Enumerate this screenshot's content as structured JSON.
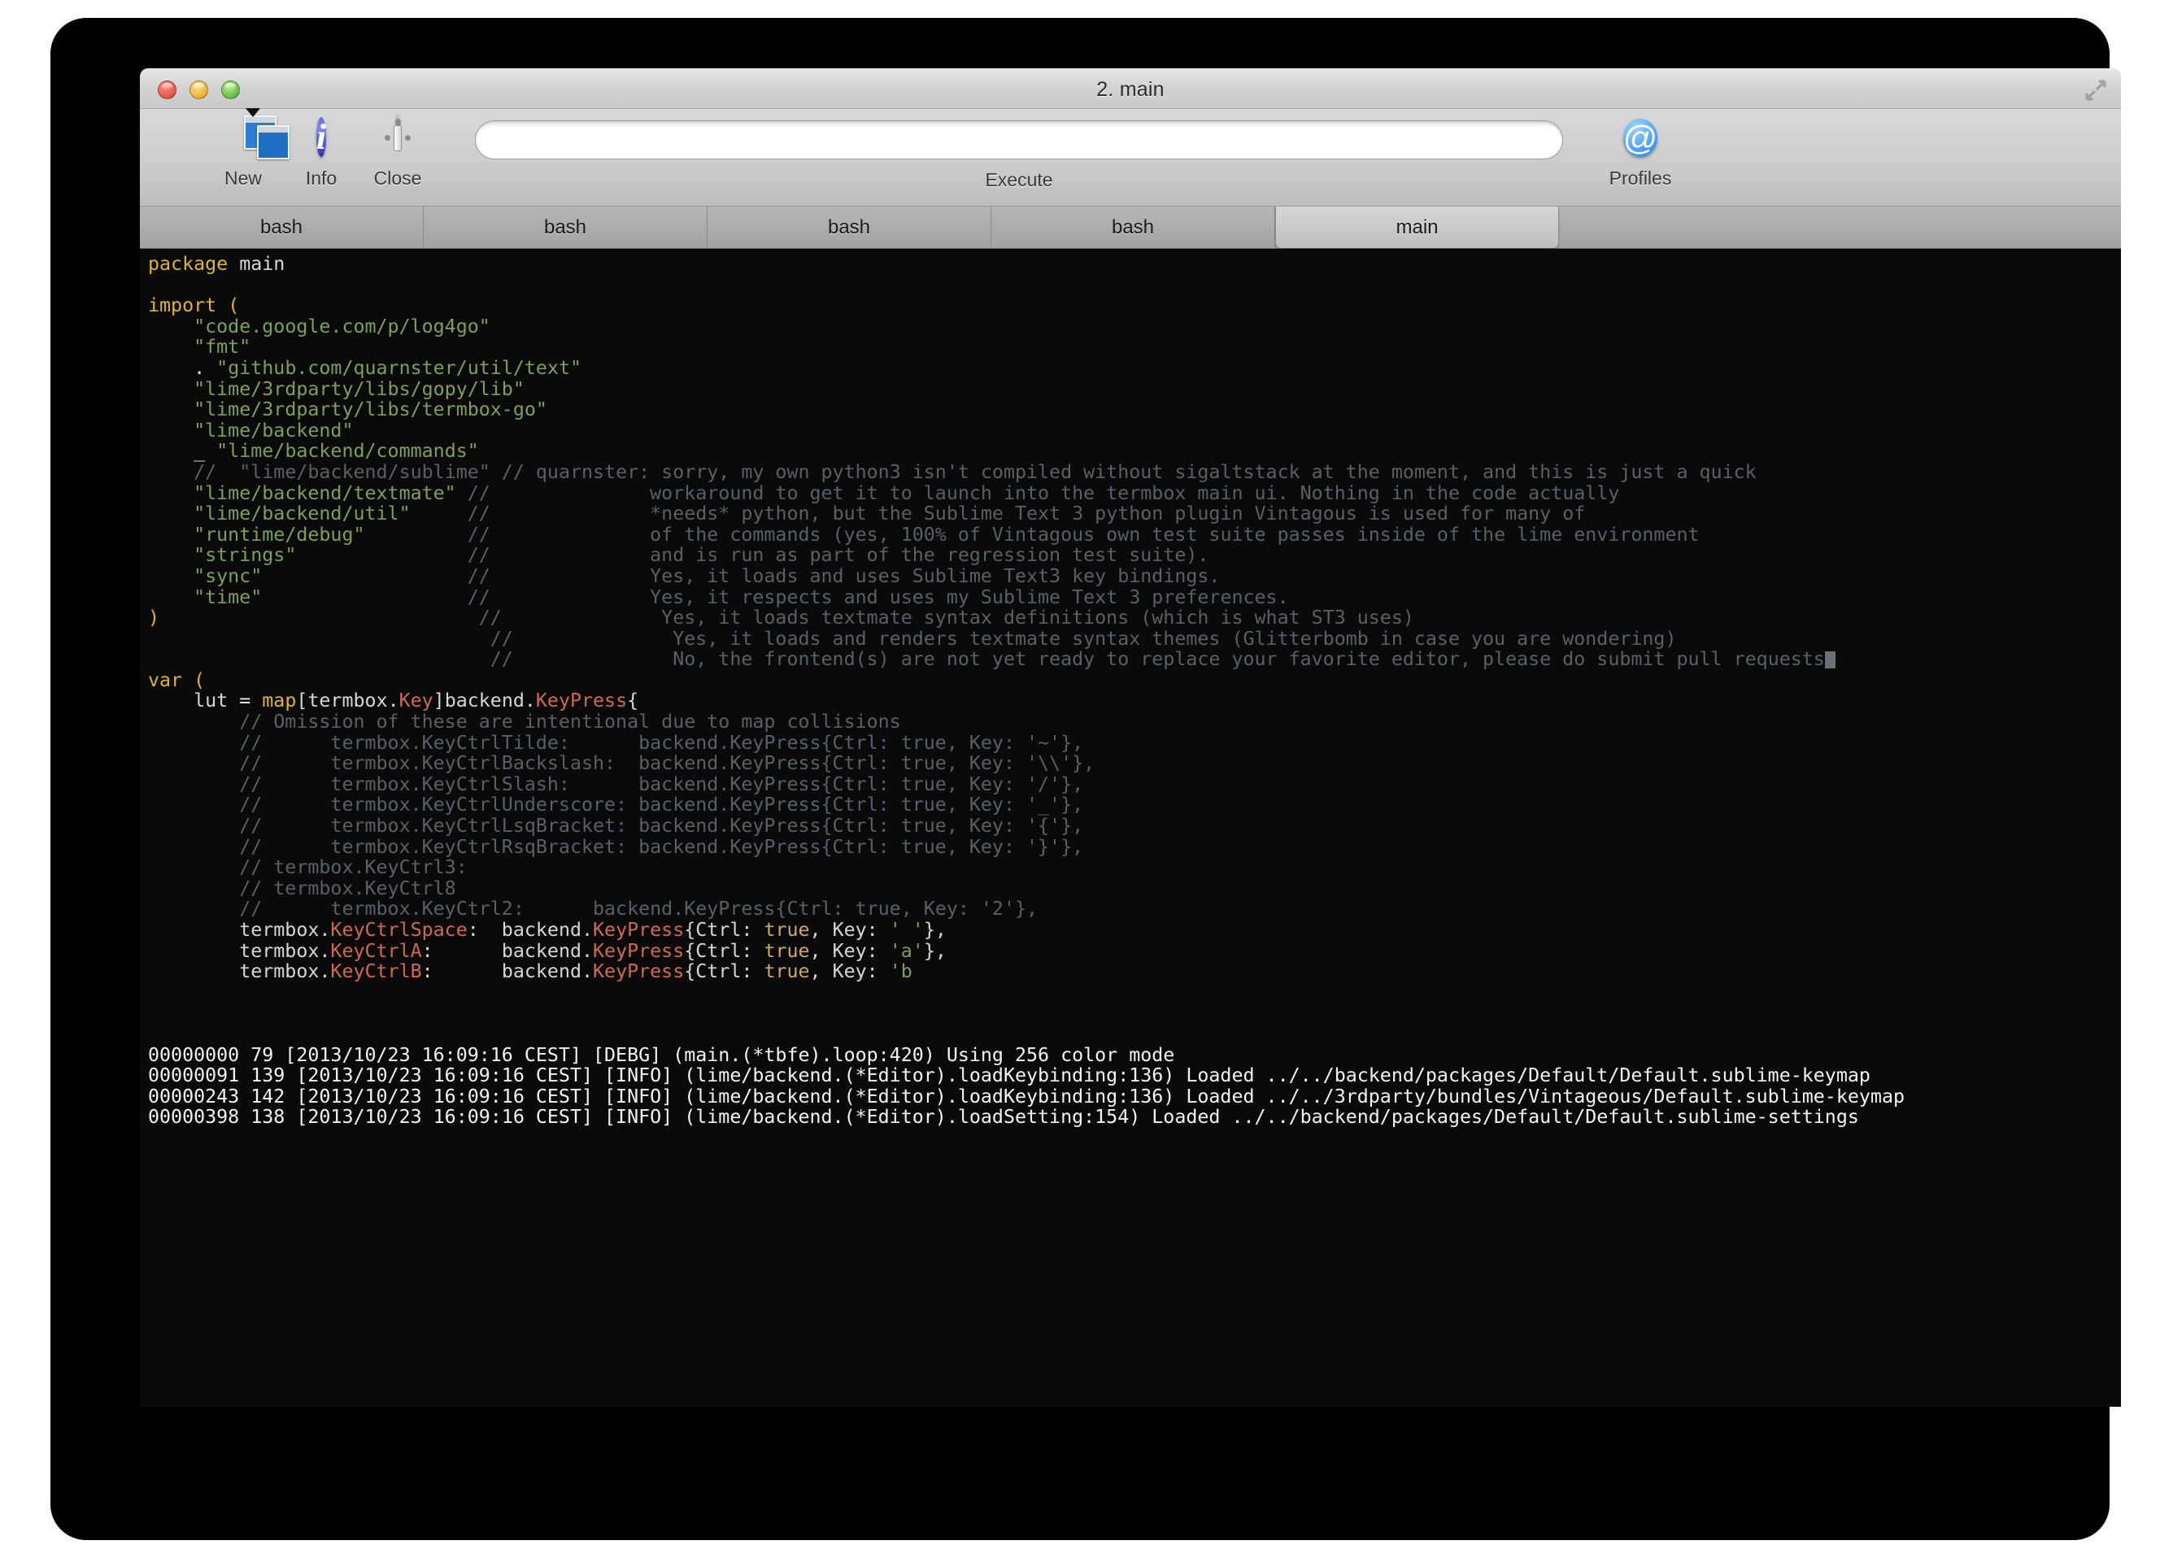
{
  "window": {
    "title": "2. main",
    "traffic_lights": [
      "close",
      "minimize",
      "maximize"
    ],
    "fullscreen_icon": "fullscreen-expand-icon"
  },
  "toolbar": {
    "items": [
      {
        "label": "New",
        "icon": "new-window-icon"
      },
      {
        "label": "Info",
        "icon": "info-icon"
      },
      {
        "label": "Close",
        "icon": "close-knob-icon"
      },
      {
        "label": "Profiles",
        "icon": "at-sign-icon"
      }
    ],
    "execute": {
      "label": "Execute",
      "value": "",
      "placeholder": ""
    }
  },
  "tabs": [
    {
      "label": "bash",
      "active": false
    },
    {
      "label": "bash",
      "active": false
    },
    {
      "label": "bash",
      "active": false
    },
    {
      "label": "bash",
      "active": false
    },
    {
      "label": "main",
      "active": true
    }
  ],
  "terminal": {
    "code_lines": [
      [
        {
          "t": "package ",
          "c": "kw"
        },
        {
          "t": "main",
          "c": "plain"
        }
      ],
      [],
      [
        {
          "t": "import ",
          "c": "kw"
        },
        {
          "t": "(",
          "c": "kw"
        }
      ],
      [
        {
          "t": "    ",
          "c": "plain"
        },
        {
          "t": "\"code.google.com/p/log4go\"",
          "c": "str"
        }
      ],
      [
        {
          "t": "    ",
          "c": "plain"
        },
        {
          "t": "\"fmt\"",
          "c": "str"
        }
      ],
      [
        {
          "t": "    ",
          "c": "plain"
        },
        {
          "t": ".",
          "c": "pun"
        },
        {
          "t": " ",
          "c": "plain"
        },
        {
          "t": "\"github.com/quarnster/util/text\"",
          "c": "str"
        }
      ],
      [
        {
          "t": "    ",
          "c": "plain"
        },
        {
          "t": "\"lime/3rdparty/libs/gopy/lib\"",
          "c": "str"
        }
      ],
      [
        {
          "t": "    ",
          "c": "plain"
        },
        {
          "t": "\"lime/3rdparty/libs/termbox-go\"",
          "c": "str"
        }
      ],
      [
        {
          "t": "    ",
          "c": "plain"
        },
        {
          "t": "\"lime/backend\"",
          "c": "str"
        }
      ],
      [
        {
          "t": "    ",
          "c": "plain"
        },
        {
          "t": "_",
          "c": "pun"
        },
        {
          "t": " ",
          "c": "plain"
        },
        {
          "t": "\"lime/backend/commands\"",
          "c": "str"
        }
      ],
      [
        {
          "t": "    ",
          "c": "plain"
        },
        {
          "t": "//  \"lime/backend/sublime\" // quarnster: sorry, my own python3 isn't compiled without sigaltstack at the moment, and this is just a quick",
          "c": "com"
        }
      ],
      [
        {
          "t": "    ",
          "c": "plain"
        },
        {
          "t": "\"lime/backend/textmate\"",
          "c": "str"
        },
        {
          "t": " //              workaround to get it to launch into the termbox main ui. Nothing in the code actually",
          "c": "com"
        }
      ],
      [
        {
          "t": "    ",
          "c": "plain"
        },
        {
          "t": "\"lime/backend/util\"",
          "c": "str"
        },
        {
          "t": "     //              *needs* python, but the Sublime Text 3 python plugin Vintagous is used for many of",
          "c": "com"
        }
      ],
      [
        {
          "t": "    ",
          "c": "plain"
        },
        {
          "t": "\"runtime/debug\"",
          "c": "str"
        },
        {
          "t": "         //              of the commands (yes, 100% of Vintagous own test suite passes inside of the lime environment",
          "c": "com"
        }
      ],
      [
        {
          "t": "    ",
          "c": "plain"
        },
        {
          "t": "\"strings\"",
          "c": "str"
        },
        {
          "t": "               //              and is run as part of the regression test suite).",
          "c": "com"
        }
      ],
      [
        {
          "t": "    ",
          "c": "plain"
        },
        {
          "t": "\"sync\"",
          "c": "str"
        },
        {
          "t": "                  //              Yes, it loads and uses Sublime Text3 key bindings.",
          "c": "com"
        }
      ],
      [
        {
          "t": "    ",
          "c": "plain"
        },
        {
          "t": "\"time\"",
          "c": "str"
        },
        {
          "t": "                  //              Yes, it respects and uses my Sublime Text 3 preferences.",
          "c": "com"
        }
      ],
      [
        {
          "t": ")",
          "c": "kw"
        },
        {
          "t": "                            //              Yes, it loads textmate syntax definitions (which is what ST3 uses)",
          "c": "com"
        }
      ],
      [
        {
          "t": "                              //              Yes, it loads and renders textmate syntax themes (Glitterbomb in case you are wondering)",
          "c": "com"
        }
      ],
      [
        {
          "t": "                              //              No, the frontend(s) are not yet ready to replace your favorite editor, please do submit pull requests",
          "c": "com"
        },
        {
          "t": "CURSOR",
          "c": "cursor"
        }
      ],
      [
        {
          "t": "var ",
          "c": "kw"
        },
        {
          "t": "(",
          "c": "kw"
        }
      ],
      [
        {
          "t": "    lut ",
          "c": "plain"
        },
        {
          "t": "= ",
          "c": "pun"
        },
        {
          "t": "map",
          "c": "kw"
        },
        {
          "t": "[termbox.",
          "c": "plain"
        },
        {
          "t": "Key",
          "c": "fn"
        },
        {
          "t": "]backend.",
          "c": "plain"
        },
        {
          "t": "KeyPress",
          "c": "fn"
        },
        {
          "t": "{",
          "c": "plain"
        }
      ],
      [
        {
          "t": "        // Omission of these are intentional due to map collisions",
          "c": "com"
        }
      ],
      [
        {
          "t": "        //      termbox.KeyCtrlTilde:      backend.KeyPress{Ctrl: true, Key: '~'},",
          "c": "com"
        }
      ],
      [
        {
          "t": "        //      termbox.KeyCtrlBackslash:  backend.KeyPress{Ctrl: true, Key: '\\\\'},",
          "c": "com"
        }
      ],
      [
        {
          "t": "        //      termbox.KeyCtrlSlash:      backend.KeyPress{Ctrl: true, Key: '/'},",
          "c": "com"
        }
      ],
      [
        {
          "t": "        //      termbox.KeyCtrlUnderscore: backend.KeyPress{Ctrl: true, Key: '_'},",
          "c": "com"
        }
      ],
      [
        {
          "t": "        //      termbox.KeyCtrlLsqBracket: backend.KeyPress{Ctrl: true, Key: '{'},",
          "c": "com"
        }
      ],
      [
        {
          "t": "        //      termbox.KeyCtrlRsqBracket: backend.KeyPress{Ctrl: true, Key: '}'},",
          "c": "com"
        }
      ],
      [
        {
          "t": "        // termbox.KeyCtrl3:",
          "c": "com"
        }
      ],
      [
        {
          "t": "        // termbox.KeyCtrl8",
          "c": "com"
        }
      ],
      [
        {
          "t": "        //      termbox.KeyCtrl2:      backend.KeyPress{Ctrl: true, Key: '2'},",
          "c": "com"
        }
      ],
      [
        {
          "t": "        termbox.",
          "c": "plain"
        },
        {
          "t": "KeyCtrlSpace",
          "c": "fn"
        },
        {
          "t": ":  backend.",
          "c": "plain"
        },
        {
          "t": "KeyPress",
          "c": "fn"
        },
        {
          "t": "{Ctrl: ",
          "c": "plain"
        },
        {
          "t": "true",
          "c": "lit"
        },
        {
          "t": ", Key: ",
          "c": "plain"
        },
        {
          "t": "' '",
          "c": "str"
        },
        {
          "t": "},",
          "c": "plain"
        }
      ],
      [
        {
          "t": "        termbox.",
          "c": "plain"
        },
        {
          "t": "KeyCtrlA",
          "c": "fn"
        },
        {
          "t": ":      backend.",
          "c": "plain"
        },
        {
          "t": "KeyPress",
          "c": "fn"
        },
        {
          "t": "{Ctrl: ",
          "c": "plain"
        },
        {
          "t": "true",
          "c": "lit"
        },
        {
          "t": ", Key: ",
          "c": "plain"
        },
        {
          "t": "'a'",
          "c": "str"
        },
        {
          "t": "},",
          "c": "plain"
        }
      ],
      [
        {
          "t": "        termbox.",
          "c": "plain"
        },
        {
          "t": "KeyCtrlB",
          "c": "fn"
        },
        {
          "t": ":      backend.",
          "c": "plain"
        },
        {
          "t": "KeyPress",
          "c": "fn"
        },
        {
          "t": "{Ctrl: ",
          "c": "plain"
        },
        {
          "t": "true",
          "c": "lit"
        },
        {
          "t": ", Key: ",
          "c": "plain"
        },
        {
          "t": "'b",
          "c": "str"
        }
      ],
      [],
      [],
      []
    ],
    "log_lines": [
      "00000000 79 [2013/10/23 16:09:16 CEST] [DEBG] (main.(*tbfe).loop:420) Using 256 color mode",
      "00000091 139 [2013/10/23 16:09:16 CEST] [INFO] (lime/backend.(*Editor).loadKeybinding:136) Loaded ../../backend/packages/Default/Default.sublime-keymap",
      "00000243 142 [2013/10/23 16:09:16 CEST] [INFO] (lime/backend.(*Editor).loadKeybinding:136) Loaded ../../3rdparty/bundles/Vintageous/Default.sublime-keymap",
      "00000398 138 [2013/10/23 16:09:16 CEST] [INFO] (lime/backend.(*Editor).loadSetting:154) Loaded ../../backend/packages/Default/Default.sublime-settings"
    ]
  },
  "colors": {
    "terminal_bg": "#0a0a0a",
    "keyword": "#ddb52a",
    "string": "#7f9f55",
    "comment": "#5a5f66",
    "function": "#cf6a4c",
    "literal": "#cda869",
    "log_text": "#f2f2f2",
    "cursor": "#6b7077",
    "titlebar": "#d3d3d3",
    "tabbar": "#a8a8a8",
    "tab_active": "#cccccc"
  }
}
